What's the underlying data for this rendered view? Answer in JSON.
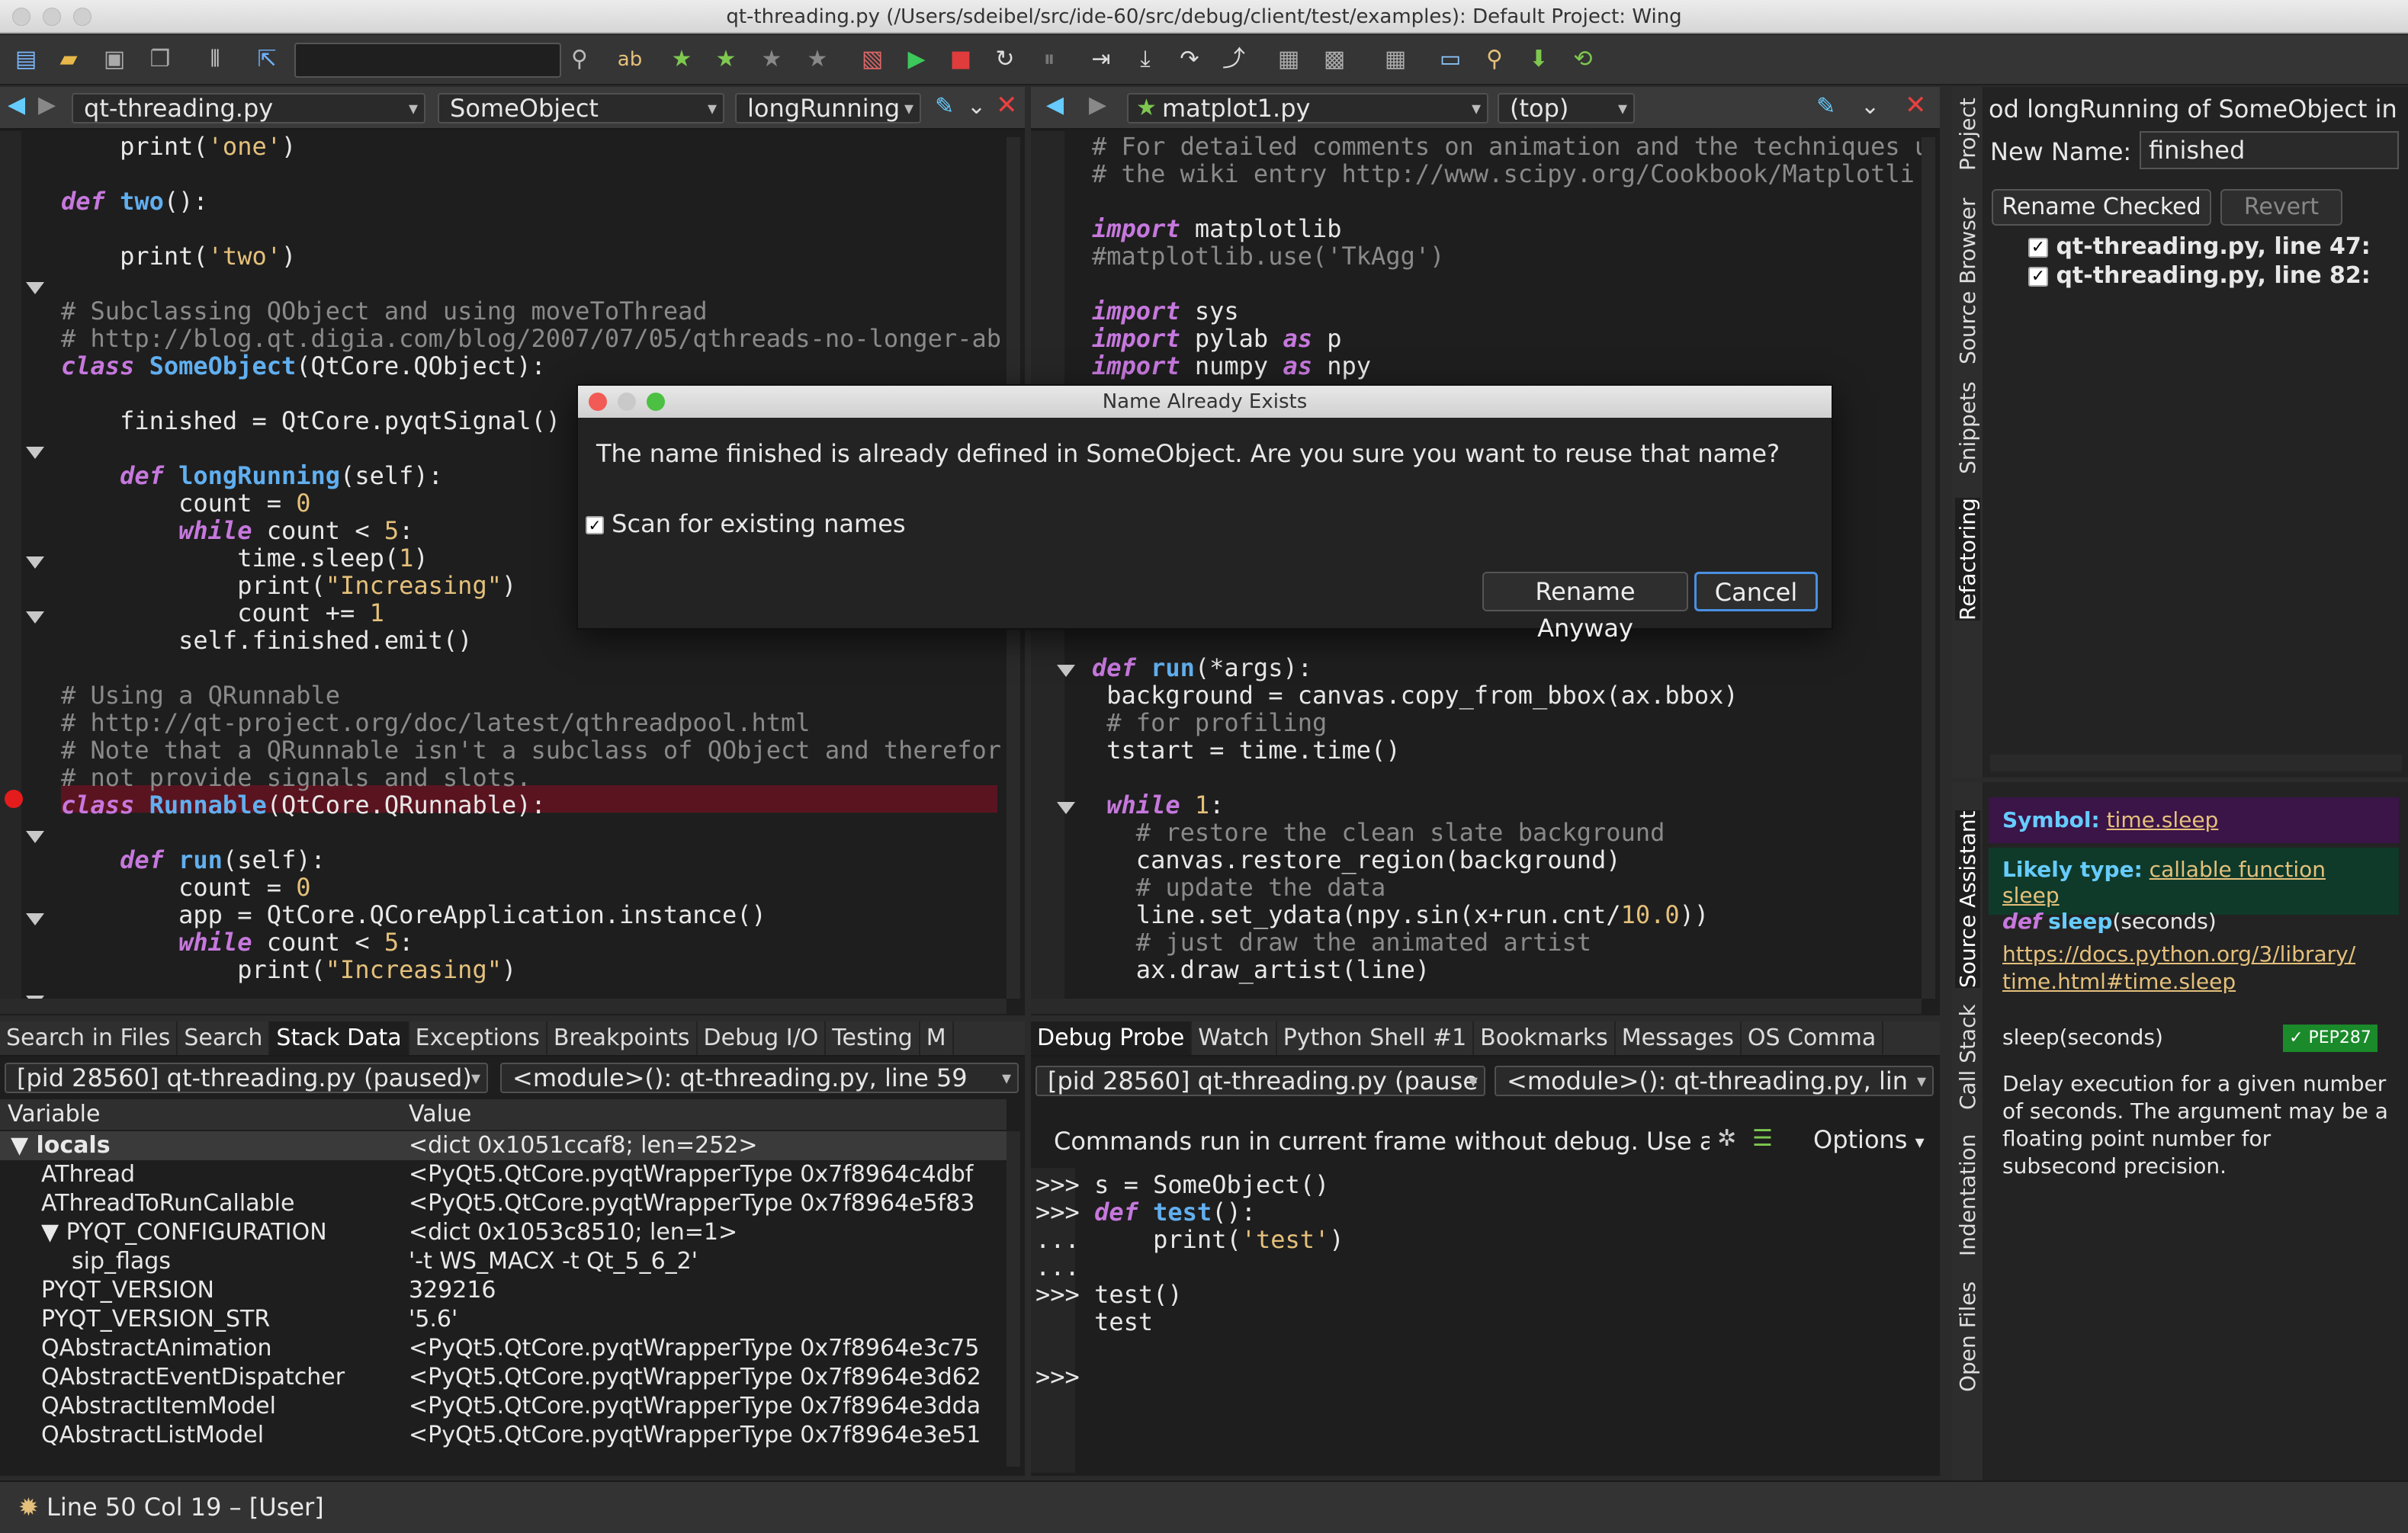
{
  "window": {
    "title": "qt-threading.py (/Users/sdeibel/src/ide-60/src/debug/client/test/examples): Default Project: Wing"
  },
  "toolbar": {
    "search_value": "",
    "icons": [
      "new-file-icon",
      "open-folder-icon",
      "save-icon",
      "save-all-icon",
      "indent-icon",
      "select-icon",
      "search-icon",
      "spell-check-icon",
      "bookmark-star-icon",
      "bookmark-next-icon",
      "bookmark-prev-icon",
      "bookmark-clear-icon",
      "debug-file-icon",
      "run-icon",
      "stop-icon",
      "restart-icon",
      "pause-icon",
      "step-over-icon",
      "step-into-icon",
      "step-out-icon",
      "step-return-icon",
      "toggle-1-icon",
      "toggle-2-icon",
      "toggle-3-icon",
      "monitor-icon",
      "find-icon",
      "down-arrow-icon",
      "refresh-icon"
    ]
  },
  "left_editor": {
    "file": "qt-threading.py",
    "scope": "SomeObject",
    "method": "longRunning",
    "lines": [
      [
        {
          "t": "    print(",
          "c": ""
        },
        {
          "t": "'one'",
          "c": "st"
        },
        {
          "t": ")",
          "c": ""
        }
      ],
      [
        {
          "t": "",
          "c": ""
        }
      ],
      [
        {
          "t": "def ",
          "c": "kw"
        },
        {
          "t": "two",
          "c": "fn"
        },
        {
          "t": "():",
          "c": ""
        }
      ],
      [
        {
          "t": "",
          "c": ""
        }
      ],
      [
        {
          "t": "    print(",
          "c": ""
        },
        {
          "t": "'two'",
          "c": "st"
        },
        {
          "t": ")",
          "c": ""
        }
      ],
      [
        {
          "t": "",
          "c": ""
        }
      ],
      [
        {
          "t": "# Subclassing QObject and using moveToThread",
          "c": "cm"
        }
      ],
      [
        {
          "t": "# http://blog.qt.digia.com/blog/2007/07/05/qthreads-no-longer-ab",
          "c": "cm"
        }
      ],
      [
        {
          "t": "class ",
          "c": "kw"
        },
        {
          "t": "SomeObject",
          "c": "fn"
        },
        {
          "t": "(QtCore.QObject):",
          "c": ""
        }
      ],
      [
        {
          "t": "",
          "c": ""
        }
      ],
      [
        {
          "t": "    finished = QtCore.pyqtSignal()",
          "c": ""
        }
      ],
      [
        {
          "t": "",
          "c": ""
        }
      ],
      [
        {
          "t": "    def ",
          "c": "kw"
        },
        {
          "t": "longRunning",
          "c": "fn"
        },
        {
          "t": "(self):",
          "c": ""
        }
      ],
      [
        {
          "t": "        count = ",
          "c": ""
        },
        {
          "t": "0",
          "c": "nm"
        }
      ],
      [
        {
          "t": "        while ",
          "c": "kw"
        },
        {
          "t": "count < ",
          "c": ""
        },
        {
          "t": "5",
          "c": "nm"
        },
        {
          "t": ":",
          "c": ""
        }
      ],
      [
        {
          "t": "            time.sleep(",
          "c": ""
        },
        {
          "t": "1",
          "c": "nm"
        },
        {
          "t": ")",
          "c": ""
        }
      ],
      [
        {
          "t": "            print(",
          "c": ""
        },
        {
          "t": "\"Increasing\"",
          "c": "st"
        },
        {
          "t": ")",
          "c": ""
        }
      ],
      [
        {
          "t": "            count += ",
          "c": ""
        },
        {
          "t": "1",
          "c": "nm"
        }
      ],
      [
        {
          "t": "        self.finished.emit()",
          "c": ""
        }
      ],
      [
        {
          "t": "",
          "c": ""
        }
      ],
      [
        {
          "t": "# Using a QRunnable",
          "c": "cm"
        }
      ],
      [
        {
          "t": "# http://qt-project.org/doc/latest/qthreadpool.html",
          "c": "cm"
        }
      ],
      [
        {
          "t": "# Note that a QRunnable isn't a subclass of QObject and therefor",
          "c": "cm"
        }
      ],
      [
        {
          "t": "# not provide signals and slots.",
          "c": "cm"
        }
      ],
      [
        {
          "t": "class ",
          "c": "kw"
        },
        {
          "t": "Runnable",
          "c": "fn"
        },
        {
          "t": "(QtCore.QRunnable):",
          "c": ""
        }
      ],
      [
        {
          "t": "",
          "c": ""
        }
      ],
      [
        {
          "t": "    def ",
          "c": "kw"
        },
        {
          "t": "run",
          "c": "fn"
        },
        {
          "t": "(self):",
          "c": ""
        }
      ],
      [
        {
          "t": "        count = ",
          "c": ""
        },
        {
          "t": "0",
          "c": "nm"
        }
      ],
      [
        {
          "t": "        app = QtCore.QCoreApplication.instance()",
          "c": ""
        }
      ],
      [
        {
          "t": "        while ",
          "c": "kw"
        },
        {
          "t": "count < ",
          "c": ""
        },
        {
          "t": "5",
          "c": "nm"
        },
        {
          "t": ":",
          "c": ""
        }
      ],
      [
        {
          "t": "            print(",
          "c": ""
        },
        {
          "t": "\"Increasing\"",
          "c": "st"
        },
        {
          "t": ")",
          "c": ""
        }
      ]
    ]
  },
  "right_editor": {
    "file": "matplot1.py",
    "scope": "(top)",
    "lines": [
      [
        {
          "t": "# For detailed comments on animation and the techniques u",
          "c": "cm"
        }
      ],
      [
        {
          "t": "# the wiki entry http://www.scipy.org/Cookbook/Matplotli",
          "c": "cm"
        }
      ],
      [
        {
          "t": "",
          "c": ""
        }
      ],
      [
        {
          "t": "import ",
          "c": "kw"
        },
        {
          "t": "matplotlib",
          "c": ""
        }
      ],
      [
        {
          "t": "#matplotlib.use('TkAgg')",
          "c": "cm"
        }
      ],
      [
        {
          "t": "",
          "c": ""
        }
      ],
      [
        {
          "t": "import ",
          "c": "kw"
        },
        {
          "t": "sys",
          "c": ""
        }
      ],
      [
        {
          "t": "import ",
          "c": "kw"
        },
        {
          "t": "pylab ",
          "c": ""
        },
        {
          "t": "as ",
          "c": "kw"
        },
        {
          "t": "p",
          "c": ""
        }
      ],
      [
        {
          "t": "import ",
          "c": "kw"
        },
        {
          "t": "numpy ",
          "c": ""
        },
        {
          "t": "as ",
          "c": "kw"
        },
        {
          "t": "npy",
          "c": ""
        }
      ]
    ],
    "lines2": [
      [
        {
          "t": "def ",
          "c": "kw"
        },
        {
          "t": "run",
          "c": "fn"
        },
        {
          "t": "(*args):",
          "c": ""
        }
      ],
      [
        {
          "t": " background = canvas.copy_from_bbox(ax.bbox)",
          "c": ""
        }
      ],
      [
        {
          "t": " # for profiling",
          "c": "cm"
        }
      ],
      [
        {
          "t": " tstart = time.time()",
          "c": ""
        }
      ],
      [
        {
          "t": "",
          "c": ""
        }
      ],
      [
        {
          "t": " while ",
          "c": "kw"
        },
        {
          "t": "1",
          "c": "nm"
        },
        {
          "t": ":",
          "c": ""
        }
      ],
      [
        {
          "t": "   # restore the clean slate background",
          "c": "cm"
        }
      ],
      [
        {
          "t": "   canvas.restore_region(background)",
          "c": ""
        }
      ],
      [
        {
          "t": "   # update the data",
          "c": "cm"
        }
      ],
      [
        {
          "t": "   line.set_ydata(npy.sin(x+run.cnt/",
          "c": ""
        },
        {
          "t": "10.0",
          "c": "nm"
        },
        {
          "t": "))",
          "c": ""
        }
      ],
      [
        {
          "t": "   # just draw the animated artist",
          "c": "cm"
        }
      ],
      [
        {
          "t": "   ax.draw_artist(line)",
          "c": ""
        }
      ]
    ]
  },
  "dialog": {
    "title": "Name Already Exists",
    "message": "The name finished is already defined in SomeObject. Are you sure you want to reuse that name?",
    "checkbox_label": "Scan for existing names",
    "checkbox_checked": true,
    "rename_label": "Rename Anyway",
    "cancel_label": "Cancel"
  },
  "refactoring": {
    "header": "od longRunning of SomeObject in",
    "new_name_label": "New Name:",
    "new_name_value": "finished",
    "rename_checked_label": "Rename Checked",
    "revert_label": "Revert",
    "items": [
      "qt-threading.py, line 47:",
      "qt-threading.py, line 82:"
    ],
    "vtabs": [
      "Project",
      "Source Browser",
      "Snippets",
      "Refactoring"
    ]
  },
  "source_assistant": {
    "symbol_label": "Symbol:",
    "symbol_value": "time.sleep",
    "likely_type_label": "Likely type:",
    "likely_type_value": "callable function sleep",
    "def_kw": "def",
    "def_name": "sleep",
    "def_args": "(seconds)",
    "doc_link_1": "https://docs.python.org/3/library/",
    "doc_link_2": "time.html#time.sleep",
    "signature": "sleep(seconds)",
    "pep_badge": "PEP287",
    "description": "Delay execution for a given number of seconds. The argument may be a floating point number for subsecond precision.",
    "vtabs": [
      "Source Assistant",
      "Call Stack",
      "Indentation",
      "Open Files"
    ]
  },
  "bottom_left": {
    "tabs": [
      "Search in Files",
      "Search",
      "Stack Data",
      "Exceptions",
      "Breakpoints",
      "Debug I/O",
      "Testing",
      "M"
    ],
    "active_tab": "Stack Data",
    "process": "[pid 28560] qt-threading.py (paused)",
    "frame": "<module>(): qt-threading.py, line 59",
    "col_variable": "Variable",
    "col_value": "Value",
    "rows": [
      {
        "name": "▼ locals",
        "value": "<dict 0x1051ccaf8; len=252>",
        "indent": 0,
        "bold": true
      },
      {
        "name": "AThread",
        "value": "<PyQt5.QtCore.pyqtWrapperType 0x7f8964c4dbf",
        "indent": 1
      },
      {
        "name": "AThreadToRunCallable",
        "value": "<PyQt5.QtCore.pyqtWrapperType 0x7f8964e5f83",
        "indent": 1
      },
      {
        "name": "▼ PYQT_CONFIGURATION",
        "value": "<dict 0x1053c8510; len=1>",
        "indent": 1
      },
      {
        "name": "sip_flags",
        "value": "'-t WS_MACX -t Qt_5_6_2'",
        "indent": 2
      },
      {
        "name": "PYQT_VERSION",
        "value": "329216",
        "indent": 1
      },
      {
        "name": "PYQT_VERSION_STR",
        "value": "'5.6'",
        "indent": 1
      },
      {
        "name": "QAbstractAnimation",
        "value": "<PyQt5.QtCore.pyqtWrapperType 0x7f8964e3c75",
        "indent": 1
      },
      {
        "name": "QAbstractEventDispatcher",
        "value": "<PyQt5.QtCore.pyqtWrapperType 0x7f8964e3d62",
        "indent": 1
      },
      {
        "name": "QAbstractItemModel",
        "value": "<PyQt5.QtCore.pyqtWrapperType 0x7f8964e3dda",
        "indent": 1
      },
      {
        "name": "QAbstractListModel",
        "value": "<PyQt5.QtCore.pyqtWrapperType 0x7f8964e3e51",
        "indent": 1
      }
    ]
  },
  "bottom_right": {
    "tabs": [
      "Debug Probe",
      "Watch",
      "Python Shell #1",
      "Bookmarks",
      "Messages",
      "OS Comma"
    ],
    "active_tab": "Debug Probe",
    "process": "[pid 28560] qt-threading.py (pause",
    "frame": "<module>(): qt-threading.py, lin",
    "info": "Commands run in current frame without debug.  Use a",
    "options_label": "Options",
    "lines": [
      [
        {
          "t": ">>> ",
          "c": ""
        },
        {
          "t": "s = SomeObject()",
          "c": ""
        }
      ],
      [
        {
          "t": ">>> ",
          "c": ""
        },
        {
          "t": "def ",
          "c": "kw"
        },
        {
          "t": "test",
          "c": "fn"
        },
        {
          "t": "():",
          "c": ""
        }
      ],
      [
        {
          "t": "...     ",
          "c": ""
        },
        {
          "t": "print(",
          "c": ""
        },
        {
          "t": "'test'",
          "c": "st"
        },
        {
          "t": ")",
          "c": ""
        }
      ],
      [
        {
          "t": "... ",
          "c": ""
        }
      ],
      [
        {
          "t": ">>> ",
          "c": ""
        },
        {
          "t": "test()",
          "c": ""
        }
      ],
      [
        {
          "t": "    test",
          "c": ""
        }
      ],
      [
        {
          "t": "",
          "c": ""
        }
      ],
      [
        {
          "t": ">>> ",
          "c": ""
        }
      ]
    ]
  },
  "status": {
    "text": "Line 50 Col 19 – [User]"
  }
}
